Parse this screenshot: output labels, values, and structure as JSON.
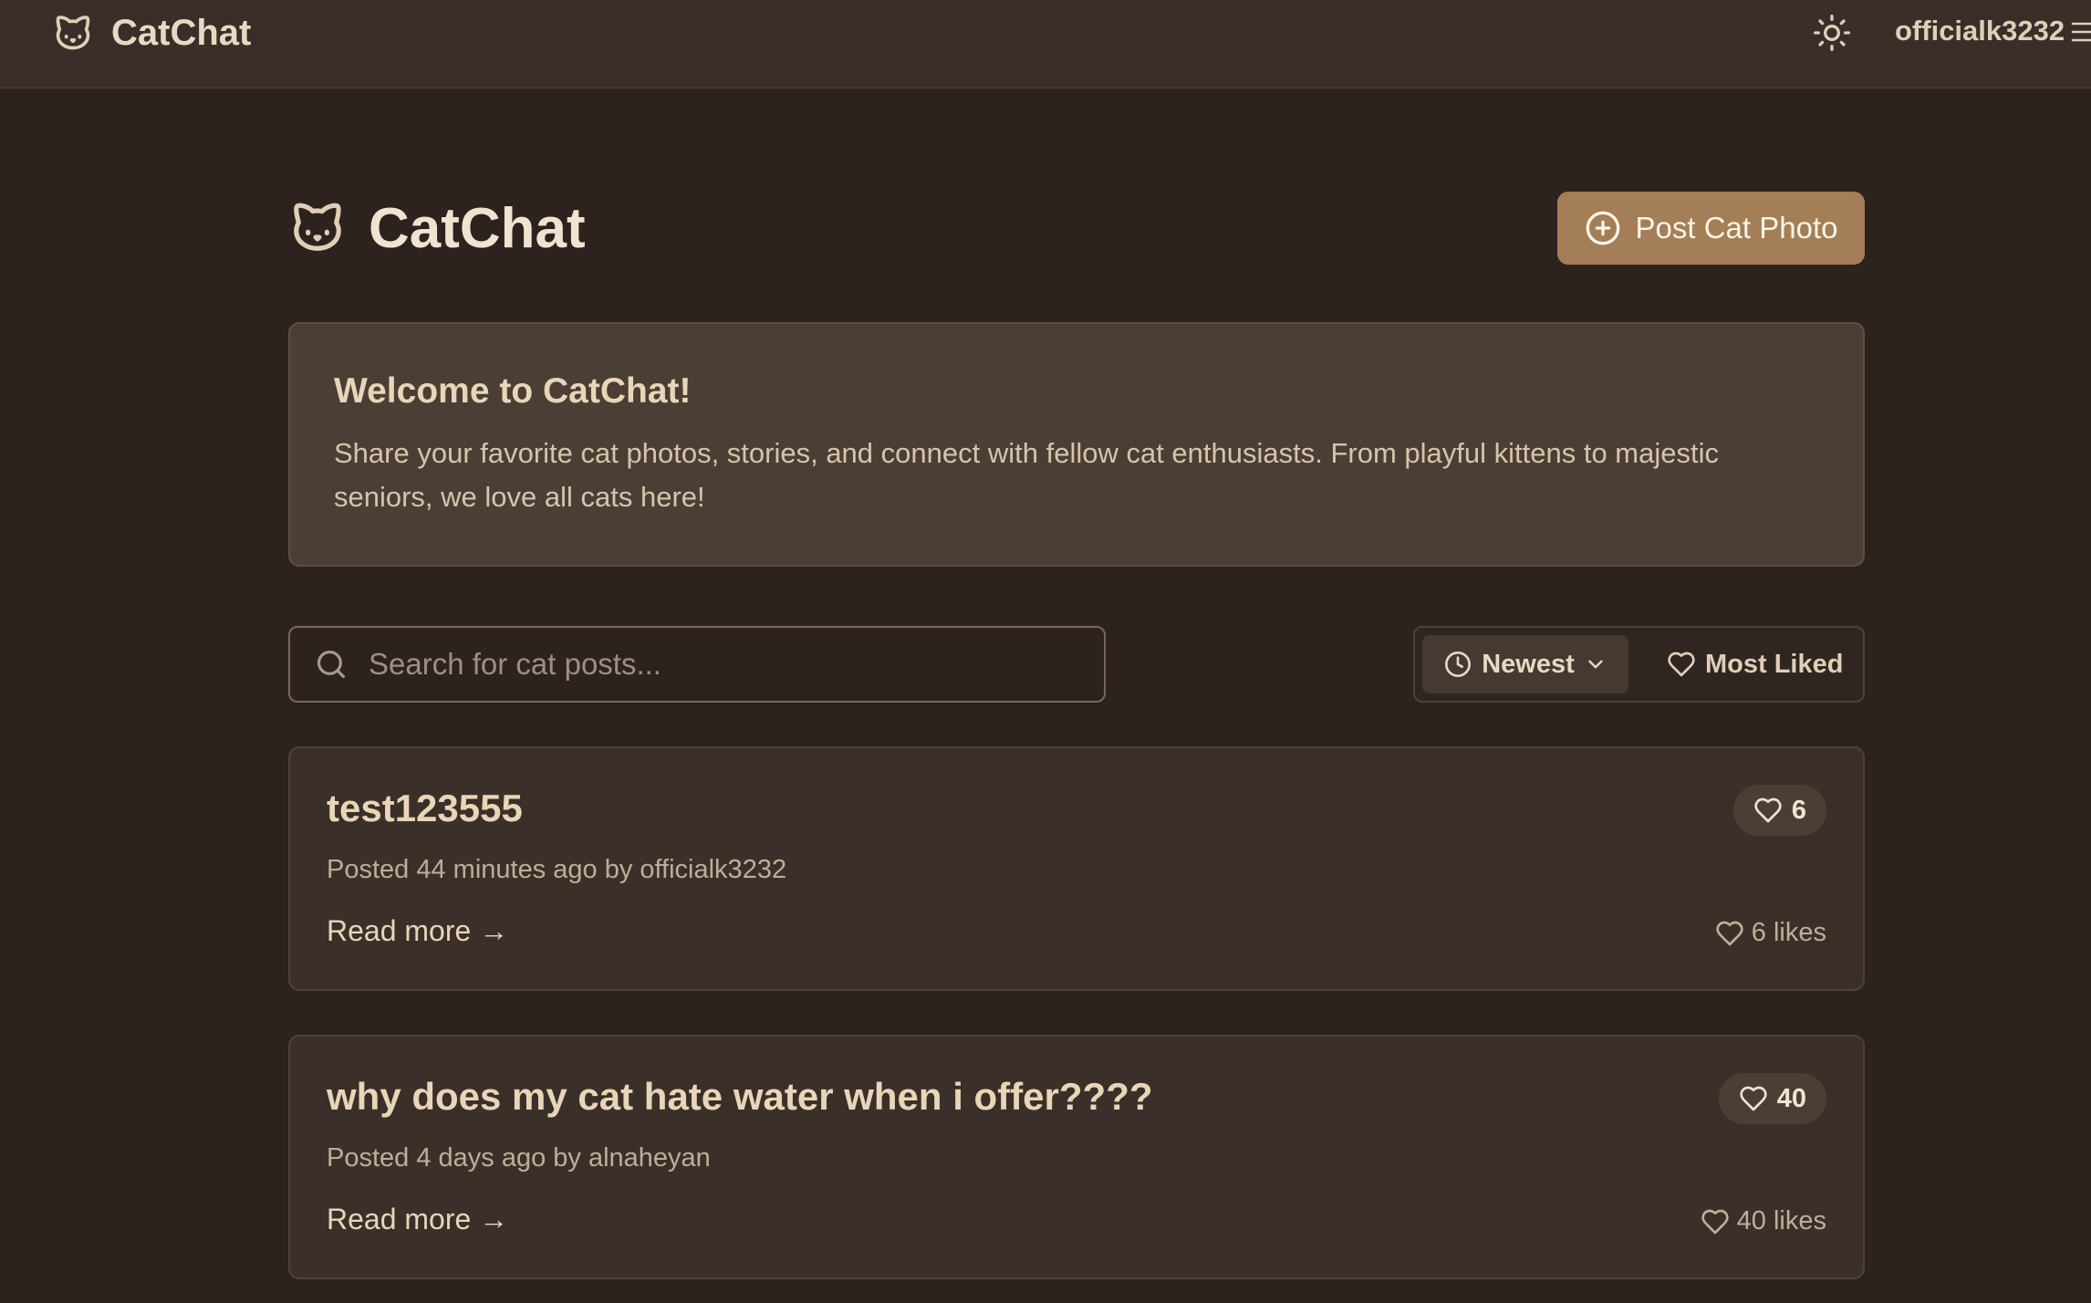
{
  "nav": {
    "brand": "CatChat",
    "username": "officialk3232"
  },
  "header": {
    "title": "CatChat",
    "post_button": "Post Cat Photo"
  },
  "welcome": {
    "title": "Welcome to CatChat!",
    "text": "Share your favorite cat photos, stories, and connect with fellow cat enthusiasts. From playful kittens to majestic seniors, we love all cats here!"
  },
  "search": {
    "placeholder": "Search for cat posts..."
  },
  "sort": {
    "newest_label": "Newest",
    "most_liked_label": "Most Liked"
  },
  "posts": [
    {
      "title": "test123555",
      "meta": "Posted 44 minutes ago by officialk3232",
      "read_more": "Read more →",
      "likes": "6",
      "likes_text": "6 likes"
    },
    {
      "title": "why does my cat hate water when i offer????",
      "meta": "Posted 4 days ago by alnaheyan",
      "read_more": "Read more →",
      "likes": "40",
      "likes_text": "40 likes"
    }
  ],
  "colors": {
    "background": "#2c231f",
    "navbar": "#3a2f28",
    "accent_button": "#a47e56",
    "welcome_card": "#4b3f35",
    "post_card": "#3b3029",
    "text_primary": "#e9d5b7"
  },
  "icons": {
    "brand": "cat-face-icon",
    "theme": "sun-icon",
    "menu": "hamburger-menu-icon",
    "post": "plus-circle-icon",
    "search": "search-icon",
    "sort_newest": "clock-icon",
    "dropdown": "chevron-down-icon",
    "likes": "heart-icon"
  }
}
